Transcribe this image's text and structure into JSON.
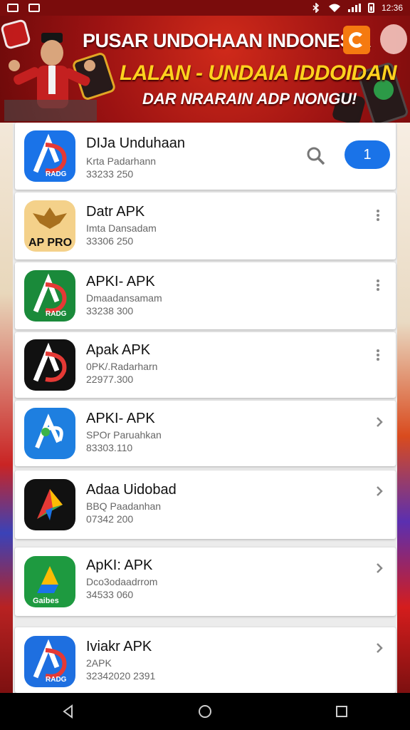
{
  "status_bar": {
    "time": "12:36"
  },
  "banner": {
    "title": "PUSAR UNDOHAAN INDONESIA",
    "subtitle": "LALAN - UNDAIA IDDOIDAN",
    "tagline": "DAR NRARAIN ADP NONGU!"
  },
  "apps": [
    {
      "name": "DIJa Unduhaan",
      "developer": "Krta Padarhann",
      "size": "33233 250",
      "icon": "adp-icon",
      "accent": "#1a73e8",
      "action": "install"
    },
    {
      "name": "Datr APK",
      "developer": "Imta Dansadam",
      "size": "33306 250",
      "icon": "garuda-icon",
      "accent": "#f4d18a",
      "action": "more",
      "icon_text": "AP PRO"
    },
    {
      "name": "APKI- APK",
      "developer": "Dmaadansamam",
      "size": "33238 300",
      "icon": "adp-green-icon",
      "accent": "#1a8a3a",
      "action": "more"
    },
    {
      "name": "Apak APK",
      "developer": "0PK/.Radarharn",
      "size": "22977.300",
      "icon": "adp-dark-icon",
      "accent": "#111111",
      "action": "more"
    },
    {
      "name": "APKI- APK",
      "developer": "SPOr Paruahkan",
      "size": "83303.110",
      "icon": "adp-blue-icon",
      "accent": "#1e7fe0",
      "action": "chevron"
    },
    {
      "name": "Adaa Uidobad",
      "developer": "BBQ Paadanhan",
      "size": "07342 200",
      "icon": "play-icon",
      "accent": "#111111",
      "action": "chevron"
    },
    {
      "name": "ApKI: APK",
      "developer": "Dco3odaadrrom",
      "size": "34533 060",
      "icon": "drive-icon",
      "accent": "#1e9a40",
      "action": "chevron",
      "icon_text": "Gaibes"
    },
    {
      "name": "Iviakr APK",
      "developer": "2APK",
      "size": "32342020 2391",
      "icon": "adp-blue2-icon",
      "accent": "#1e6fe0",
      "action": "chevron"
    }
  ],
  "install_label": "1"
}
